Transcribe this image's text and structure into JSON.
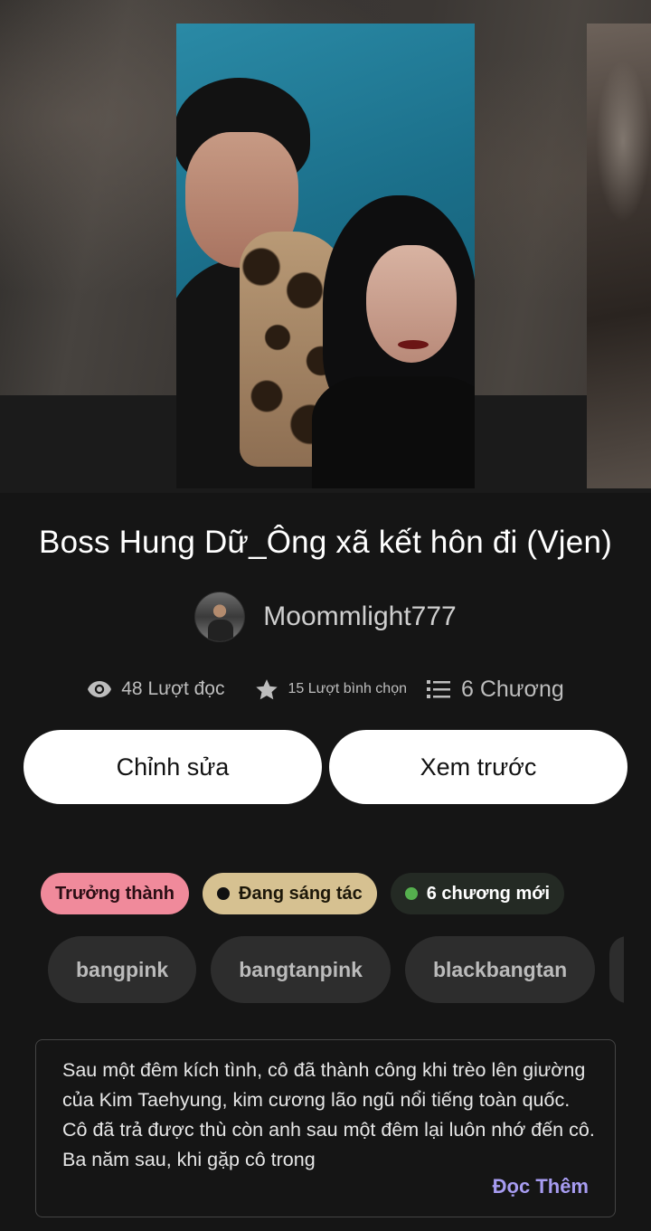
{
  "story": {
    "title": "Boss Hung Dữ_Ông xã kết hôn đi (Vjen)",
    "author": "Moommlight777",
    "stats": {
      "reads": "48 Lượt đọc",
      "votes": "15 Lượt bình chọn",
      "parts": "6 Chương"
    },
    "actions": {
      "edit_label": "Chỉnh sửa",
      "preview_label": "Xem trước"
    },
    "pills": {
      "mature": "Trưởng thành",
      "status": "Đang sáng tác",
      "new_parts": "6 chương mới"
    },
    "tags": [
      "bangpink",
      "bangtanpink",
      "blackbangtan"
    ],
    "description": "Sau một đêm kích tình, cô đã thành công khi trèo lên giường của Kim Taehyung, kim cương lão ngũ nổi tiếng toàn quốc. Cô đã trả được thù còn anh sau một đêm lại luôn nhớ đến cô. Ba năm sau, khi gặp cô trong",
    "read_more": "Đọc Thêm"
  },
  "colors": {
    "background": "#151515",
    "mature_pill": "#f08a9b",
    "status_pill": "#d6c191",
    "new_dot": "#55b04e",
    "read_more": "#a79cf1"
  },
  "icons": {
    "reads": "eye-icon",
    "votes": "star-icon",
    "parts": "list-icon"
  }
}
